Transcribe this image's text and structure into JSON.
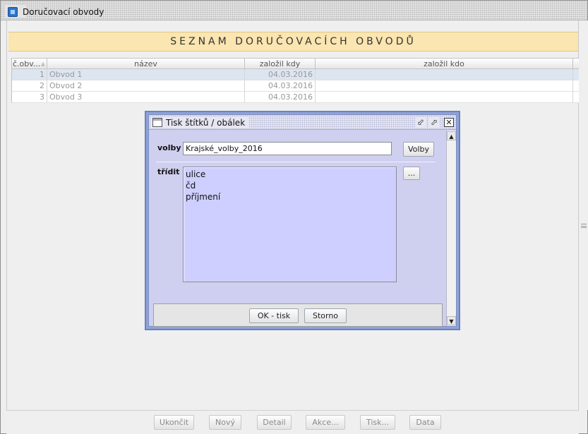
{
  "window": {
    "title": "Doručovací obvody"
  },
  "banner": {
    "title": "SEZNAM DORUČOVACÍCH OBVODŮ"
  },
  "table": {
    "columns": [
      "č.obv...",
      "název",
      "založil kdy",
      "založil kdo"
    ],
    "rows": [
      {
        "num": "1",
        "name": "Obvod 1",
        "created": "04.03.2016",
        "author": ""
      },
      {
        "num": "2",
        "name": "Obvod 2",
        "created": "04.03.2016",
        "author": ""
      },
      {
        "num": "3",
        "name": "Obvod 3",
        "created": "04.03.2016",
        "author": ""
      }
    ]
  },
  "dialog": {
    "title": "Tisk štítků / obálek",
    "volby_label": "volby",
    "volby_value": "Krajské_volby_2016",
    "volby_button": "Volby",
    "tridit_label": "třídit",
    "tridit_button": "...",
    "sort_items": [
      "ulice",
      "čd",
      "příjmení"
    ],
    "ok_button": "OK - tisk",
    "cancel_button": "Storno",
    "title_buttons": {
      "minimize": "⬃",
      "maximize": "⬀",
      "close": "✕"
    }
  },
  "toolbar": {
    "ukoncit": "Ukončit",
    "novy": "Nový",
    "detail": "Detail",
    "akce": "Akce...",
    "tisk": "Tisk...",
    "data": "Data"
  },
  "icons": {
    "window": "app-window-icon",
    "dialog": "dialog-window-icon",
    "sort_indicator": "sort-ascending-icon"
  }
}
